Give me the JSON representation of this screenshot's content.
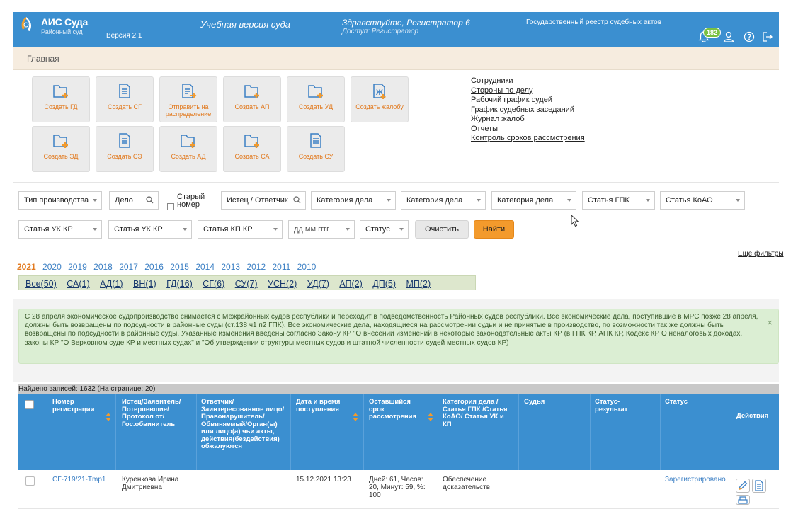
{
  "header": {
    "app_title": "АИС Суда",
    "app_subtitle": "Районный суд",
    "version": "Версия 2.1",
    "edu_version": "Учебная версия суда",
    "greeting": "Здравствуйте, Регистратор 6",
    "access": "Доступ: Регистратор",
    "registry_link": "Государственный реестр судебных актов",
    "notifications_count": "182",
    "icons": [
      "bell-icon",
      "user-icon",
      "help-icon",
      "logout-icon"
    ],
    "color": "#3b8fd0"
  },
  "breadcrumb": "Главная",
  "quick_buttons": [
    {
      "label": "Создать ГД",
      "icon": "folder-plus-icon"
    },
    {
      "label": "Создать СГ",
      "icon": "document-icon"
    },
    {
      "label": "Отправить на распределение",
      "icon": "document-send-icon"
    },
    {
      "label": "Создать АП",
      "icon": "folder-plus-icon"
    },
    {
      "label": "Создать УД",
      "icon": "folder-plus-icon"
    },
    {
      "label": "Создать жалобу",
      "icon": "complaint-icon"
    },
    {
      "label": "Создать ЭД",
      "icon": "folder-plus-icon"
    },
    {
      "label": "Создать СЭ",
      "icon": "document-icon"
    },
    {
      "label": "Создать АД",
      "icon": "folder-plus-icon"
    },
    {
      "label": "Создать СА",
      "icon": "folder-plus-icon"
    },
    {
      "label": "Создать СУ",
      "icon": "document-icon"
    }
  ],
  "links": [
    "Сотрудники",
    "Стороны по делу",
    "Рабочий график судей",
    "График судебных заседаний",
    "Журнал жалоб",
    "Отчеты",
    "Контроль сроков рассмотрения"
  ],
  "filters": {
    "proc_type": "Тип производства",
    "case": "Дело",
    "old_number": "Старый номер",
    "party": "Истец / Ответчик",
    "category1": "Категория дела",
    "category2": "Категория дела",
    "category3": "Категория дела",
    "gpk": "Статья ГПК",
    "koao": "Статья КоАО",
    "uk1": "Статья УК КР",
    "uk2": "Статья УК КР",
    "kp": "Статья КП КР",
    "date_placeholder": "дд.мм.гггг",
    "status": "Статус",
    "clear": "Очистить",
    "find": "Найти",
    "more": "Еще фильтры"
  },
  "years": [
    "2021",
    "2020",
    "2019",
    "2018",
    "2017",
    "2016",
    "2015",
    "2014",
    "2013",
    "2012",
    "2011",
    "2010"
  ],
  "active_year": "2021",
  "categories": [
    "Все(50)",
    "СА(1)",
    "АД(1)",
    "ВН(1)",
    "ГД(16)",
    "СГ(6)",
    "СУ(7)",
    "УСН(2)",
    "УД(7)",
    "АП(2)",
    "ДП(5)",
    "МП(2)"
  ],
  "notice": "С 28 апреля экономическое судопроизводство снимается с Межрайонных судов республики и переходит в подведомственность Районных судов республики. Все экономические дела, поступившие в МРС позже 28 апреля, должны быть возвращены по подсудности в районные суды (ст.138 ч1 п2 ГПК). Все экономические дела, находящиеся на рассмотрении судьи и не принятые в производство, по возможности так же должны быть возвращены по подсудности в районные суды. Указанные изменения введены согласно Закону КР \"О внесении изменений в некоторые законодательные акты КР (в ГПК КР, АПК КР, Кодекс КР О неналоговых доходах, законы КР \"О Верховном суде КР и местных судах\" и \"Об утверждении структуры местных судов и штатной численности судей местных судов КР)",
  "notice_close": "×",
  "table": {
    "found": "Найдено записей: 1632 (На странице: 20)",
    "headers": {
      "number": "Номер регистрации",
      "plaintiff": "Истец/Заявитель/ Потерпевшие/ Протокол от/ Гос.обвинитель",
      "defendant": "Ответчик/ Заинтересованное лицо/ Правонарушитель/ Обвиняемый/Орган(ы) или лицо(а) чьи акты, действия(бездействия) обжалуются",
      "date": "Дата и время поступления",
      "remaining": "Оставшийся срок рассмотрения",
      "category": "Категория дела / Статья ГПК /Статья КоАО/ Статья УК и КП",
      "judge": "Судья",
      "status_result": "Статус-результат",
      "status": "Статус",
      "actions": "Действия"
    },
    "rows": [
      {
        "number": "СГ-719/21-Tmp1",
        "plaintiff": "Куренкова Ирина Дмитриевна",
        "defendant": "",
        "date": "15.12.2021 13:23",
        "remaining": "Дней: 61, Часов: 20, Минут: 59, %: 100",
        "category": "Обеспечение доказательств",
        "judge": "",
        "status_result": "",
        "status": "Зарегистрировано"
      }
    ]
  }
}
